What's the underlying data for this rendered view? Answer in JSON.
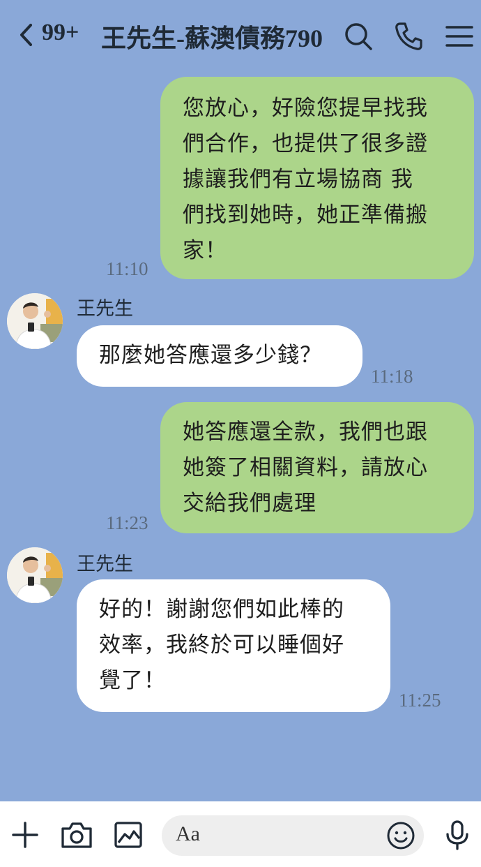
{
  "header": {
    "unread_badge": "99+",
    "title": "王先生-蘇澳債務790",
    "icons": [
      "back-chevron-icon",
      "search-icon",
      "phone-icon",
      "menu-icon"
    ]
  },
  "messages": [
    {
      "direction": "out",
      "text_lines": [
        "您放心，好險您提早找我",
        "們合作，也提供了很多證",
        "據讓我們有立場協商 我",
        "們找到她時，她正準備搬",
        "家！"
      ],
      "time": "11:10"
    },
    {
      "direction": "in",
      "sender": "王先生",
      "text_lines": [
        "那麼她答應還多少錢？"
      ],
      "time": "11:18"
    },
    {
      "direction": "out",
      "text_lines": [
        "她答應還全款，我們也跟",
        "她簽了相關資料，請放心",
        "交給我們處理"
      ],
      "time": "11:23"
    },
    {
      "direction": "in",
      "sender": "王先生",
      "text_lines": [
        "好的！謝謝您們如此棒的",
        "效率，我終於可以睡個好",
        "覺了！"
      ],
      "time": "11:25"
    }
  ],
  "input_bar": {
    "placeholder": "Aa",
    "icons": [
      "plus-icon",
      "camera-icon",
      "image-icon",
      "emoji-icon",
      "microphone-icon"
    ]
  },
  "colors": {
    "background": "#8aa8d8",
    "outgoing_bubble": "#acd58a",
    "incoming_bubble": "#ffffff"
  }
}
